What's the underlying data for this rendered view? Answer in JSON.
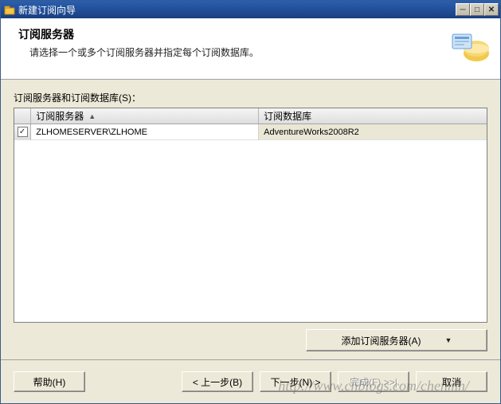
{
  "window": {
    "title": "新建订阅向导"
  },
  "header": {
    "title": "订阅服务器",
    "subtitle": "请选择一个或多个订阅服务器并指定每个订阅数据库。"
  },
  "grid": {
    "label": "订阅服务器和订阅数据库(S)：",
    "columns": {
      "server": "订阅服务器",
      "database": "订阅数据库"
    },
    "rows": [
      {
        "checked": true,
        "server": "ZLHOMESERVER\\ZLHOME",
        "database": "AdventureWorks2008R2"
      }
    ]
  },
  "addButton": "添加订阅服务器(A)",
  "footer": {
    "help": "帮助(H)",
    "back": "< 上一步(B)",
    "next": "下一步(N) >",
    "finish": "完成(F) >>|",
    "cancel": "取消"
  },
  "watermark": "http://www.cnblogs.com/chenmh/"
}
